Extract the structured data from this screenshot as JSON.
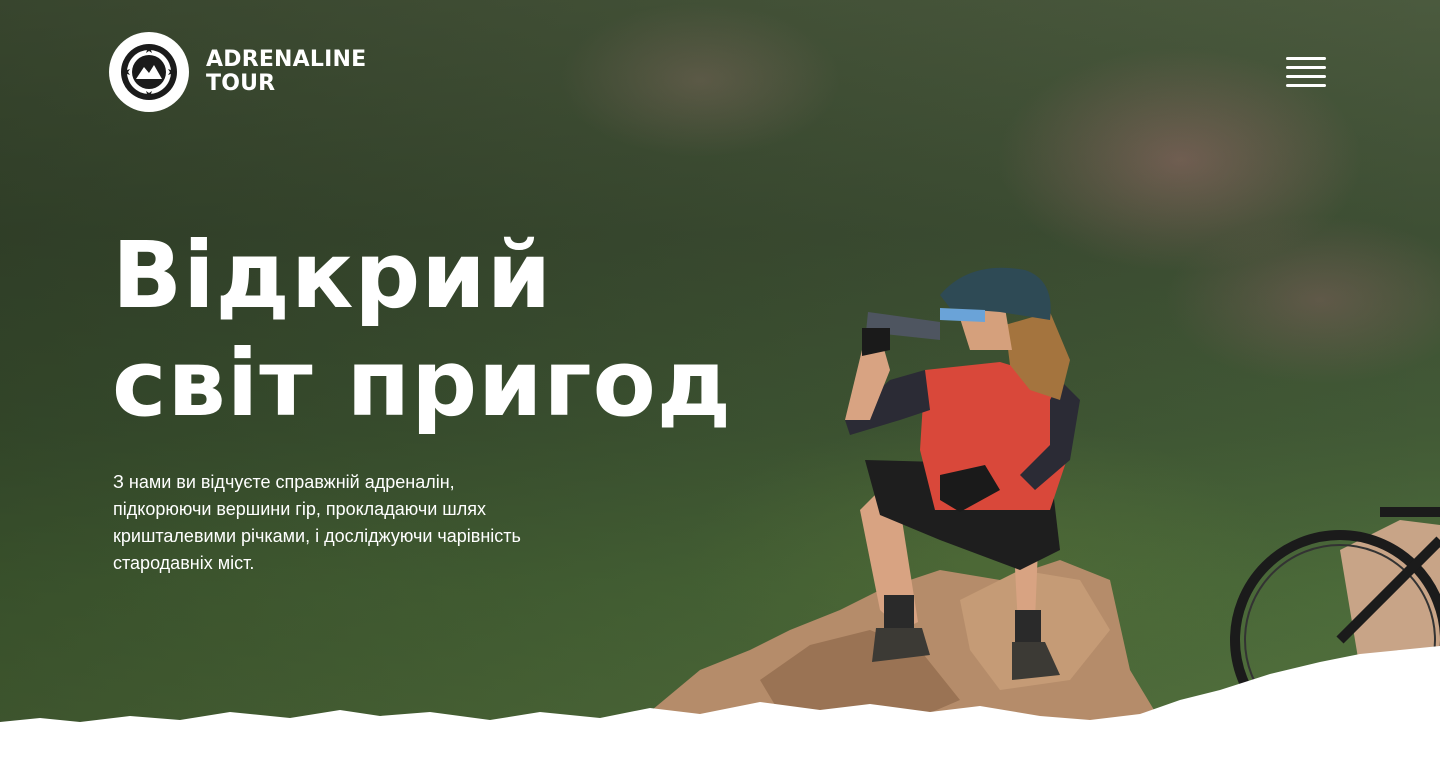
{
  "brand": {
    "name_line1": "ADRENALINE",
    "name_line2": "TOUR",
    "logo_icon": "mountain-compass-badge-icon",
    "badge_text": "ADRENALINE TOUR"
  },
  "nav": {
    "menu_icon": "hamburger-menu-icon"
  },
  "hero": {
    "title_line1": "Відкрий",
    "title_line2": "світ пригод",
    "description": "З нами ви відчуєте справжній адреналін, підкорюючи вершини гір, прокладаючи шлях кришталевими річками, і досліджуючи чарівність стародавніх міст."
  },
  "colors": {
    "text": "#ffffff",
    "jersey_accent": "#d9483a",
    "background": "#ffffff"
  }
}
